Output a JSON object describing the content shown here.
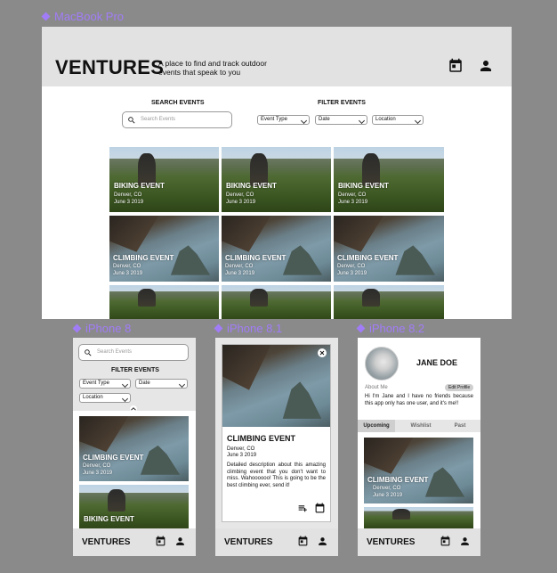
{
  "frames": {
    "desktop": "MacBook Pro",
    "iphone8": "iPhone 8",
    "iphone8_1": "iPhone 8.1",
    "iphone8_2": "iPhone 8.2"
  },
  "app": {
    "logo": "VENTURES",
    "tagline": "A place to find and track outdoor events that speak to you"
  },
  "search": {
    "title": "SEARCH EVENTS",
    "placeholder": "Search Events"
  },
  "filter": {
    "title": "FILTER EVENTS",
    "event_type": "Event Type",
    "date": "Date",
    "location": "Location"
  },
  "events": {
    "biking": {
      "title": "BIKING EVENT",
      "location": "Denver, CO",
      "date": "June 3 2019"
    },
    "climbing": {
      "title": "CLIMBING EVENT",
      "location": "Denver, CO",
      "date": "June 3 2019"
    }
  },
  "detail": {
    "title": "CLIMBING EVENT",
    "location": "Denver, CO",
    "date": "June 3 2019",
    "description": "Detailed description about this amazing climbing event that you don't want to miss. Wahoooooo! This is going to be the best climbing ever, send it!"
  },
  "profile": {
    "name": "JANE DOE",
    "about_label": "About Me",
    "edit_label": "Edit Profile",
    "about_text": "Hi I'm Jane and I have no friends because this app only has one user, and it's me!!",
    "tabs": [
      "Upcoming",
      "Wishlist",
      "Past"
    ]
  },
  "icons": {
    "calendar": "calendar-icon",
    "person": "person-icon",
    "search": "search-icon",
    "close": "close-icon",
    "playlist_add": "playlist-add-icon",
    "collapse": "chevron-up-icon"
  }
}
